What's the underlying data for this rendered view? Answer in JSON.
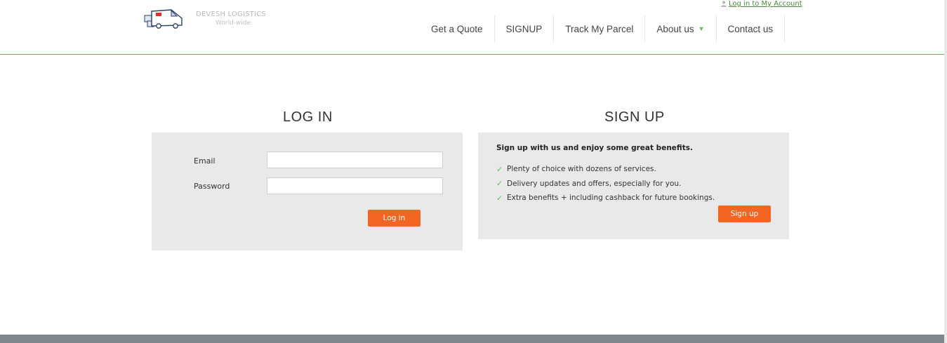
{
  "brand": {
    "name": "DEVESH LOGISTICS",
    "tagline": "World-wide",
    "logo_icon": "delivery-van-icon"
  },
  "account": {
    "link_label": "Log in to My Account",
    "icon": "user-icon"
  },
  "nav": {
    "items": [
      {
        "label": "Get a Quote"
      },
      {
        "label": "SIGNUP"
      },
      {
        "label": "Track My Parcel"
      },
      {
        "label": "About us",
        "has_dropdown": true
      },
      {
        "label": "Contact us"
      }
    ]
  },
  "login": {
    "title": "LOG IN",
    "email_label": "Email",
    "email_value": "",
    "password_label": "Password",
    "password_value": "",
    "button_label": "Log in"
  },
  "signup": {
    "title": "SIGN UP",
    "intro": "Sign up with us and enjoy some great benefits.",
    "benefits": [
      "Plenty of choice with dozens of services.",
      "Delivery updates and offers, especially for you.",
      "Extra benefits + including cashback for future bookings."
    ],
    "button_label": "Sign up"
  },
  "colors": {
    "accent_green": "#5cb85c",
    "button_orange": "#f26522",
    "panel_gray": "#e9e9e9",
    "footer_gray": "#7f868c"
  }
}
